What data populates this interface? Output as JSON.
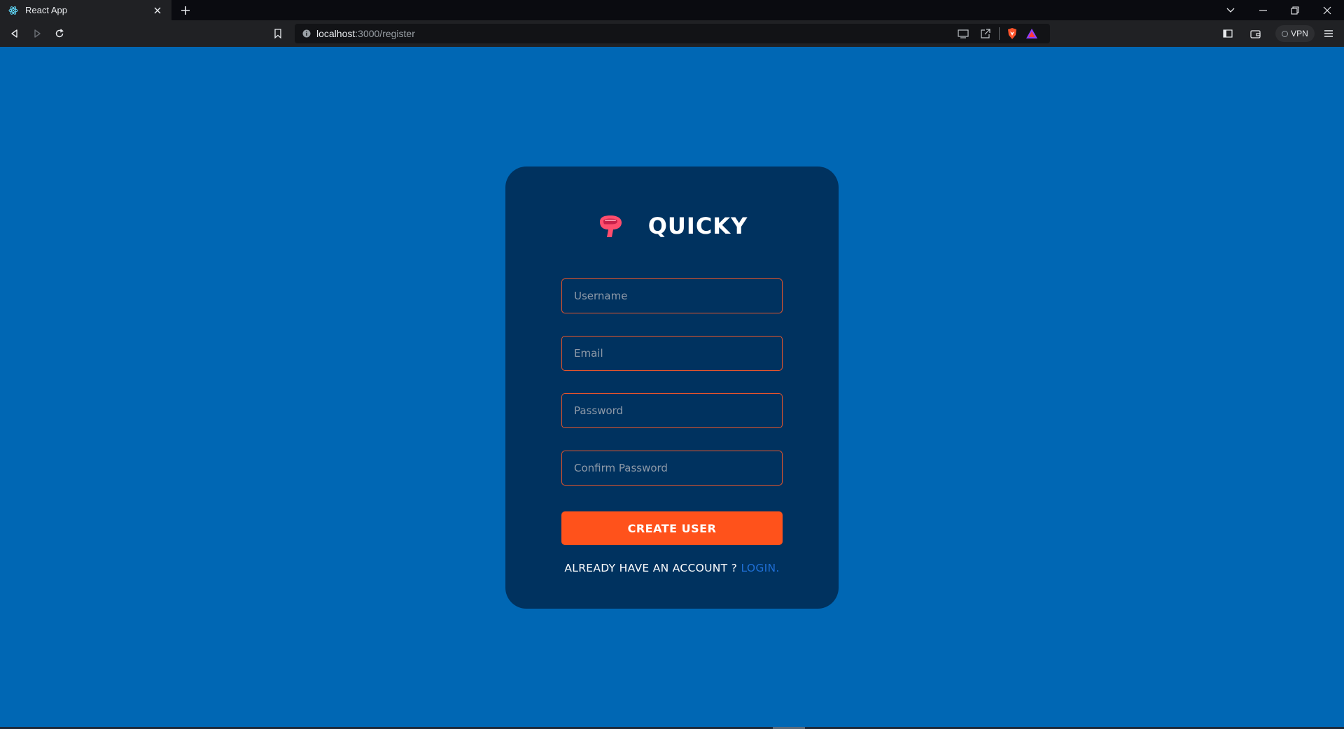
{
  "browser": {
    "tab_title": "React App",
    "url_host": "localhost",
    "url_path": ":3000/register",
    "vpn_label": "VPN"
  },
  "brand": {
    "name": "QUICKY",
    "logo_color": "#ff4d6d"
  },
  "form": {
    "username_placeholder": "Username",
    "email_placeholder": "Email",
    "password_placeholder": "Password",
    "confirm_password_placeholder": "Confirm Password",
    "submit_label": "CREATE USER",
    "footer_text": "ALREADY HAVE AN ACCOUNT ? ",
    "login_label": "LOGIN."
  },
  "colors": {
    "page_background": "#0067b4",
    "card_background": "#00325f",
    "accent": "#ff521b",
    "link": "#1f6fd6"
  }
}
